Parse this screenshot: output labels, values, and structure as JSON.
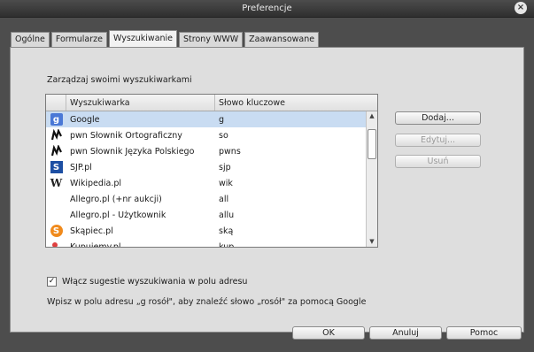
{
  "window": {
    "title": "Preferencje",
    "close_glyph": "×"
  },
  "tabs": [
    {
      "label": "Ogólne",
      "active": false
    },
    {
      "label": "Formularze",
      "active": false
    },
    {
      "label": "Wyszukiwanie",
      "active": true
    },
    {
      "label": "Strony WWW",
      "active": false
    },
    {
      "label": "Zaawansowane",
      "active": false
    }
  ],
  "search": {
    "section_title": "Zarządzaj swoimi wyszukiwarkami",
    "columns": {
      "name": "Wyszukiwarka",
      "keyword": "Słowo kluczowe"
    },
    "engines": [
      {
        "icon": "google-icon",
        "name": "Google",
        "keyword": "g",
        "selected": true
      },
      {
        "icon": "pwn-icon",
        "name": "pwn Słownik Ortograficzny",
        "keyword": "so",
        "selected": false
      },
      {
        "icon": "pwn-icon",
        "name": "pwn Słownik Języka Polskiego",
        "keyword": "pwns",
        "selected": false
      },
      {
        "icon": "sjp-icon",
        "name": "SJP.pl",
        "keyword": "sjp",
        "selected": false
      },
      {
        "icon": "wikipedia-icon",
        "name": "Wikipedia.pl",
        "keyword": "wik",
        "selected": false
      },
      {
        "icon": "none",
        "name": "Allegro.pl (+nr aukcji)",
        "keyword": "all",
        "selected": false
      },
      {
        "icon": "none",
        "name": "Allegro.pl - Użytkownik",
        "keyword": "allu",
        "selected": false
      },
      {
        "icon": "skapiec-icon",
        "name": "Skąpiec.pl",
        "keyword": "ską",
        "selected": false
      },
      {
        "icon": "kupujemy-icon",
        "name": "Kupujemy.pl",
        "keyword": "kup",
        "selected": false
      }
    ],
    "buttons": {
      "add": "Dodaj...",
      "edit": "Edytuj...",
      "remove": "Usuń"
    },
    "suggestions_checkbox": {
      "label": "Włącz sugestie wyszukiwania w polu adresu",
      "checked": true
    },
    "hint": "Wpisz w polu adresu „g rosół\", aby znaleźć słowo „rosół\" za pomocą Google"
  },
  "footer": {
    "ok": "OK",
    "cancel": "Anuluj",
    "help": "Pomoc"
  },
  "colors": {
    "selection": "#c9dcf2",
    "panel": "#dedede",
    "frame": "#4d4d4d"
  }
}
